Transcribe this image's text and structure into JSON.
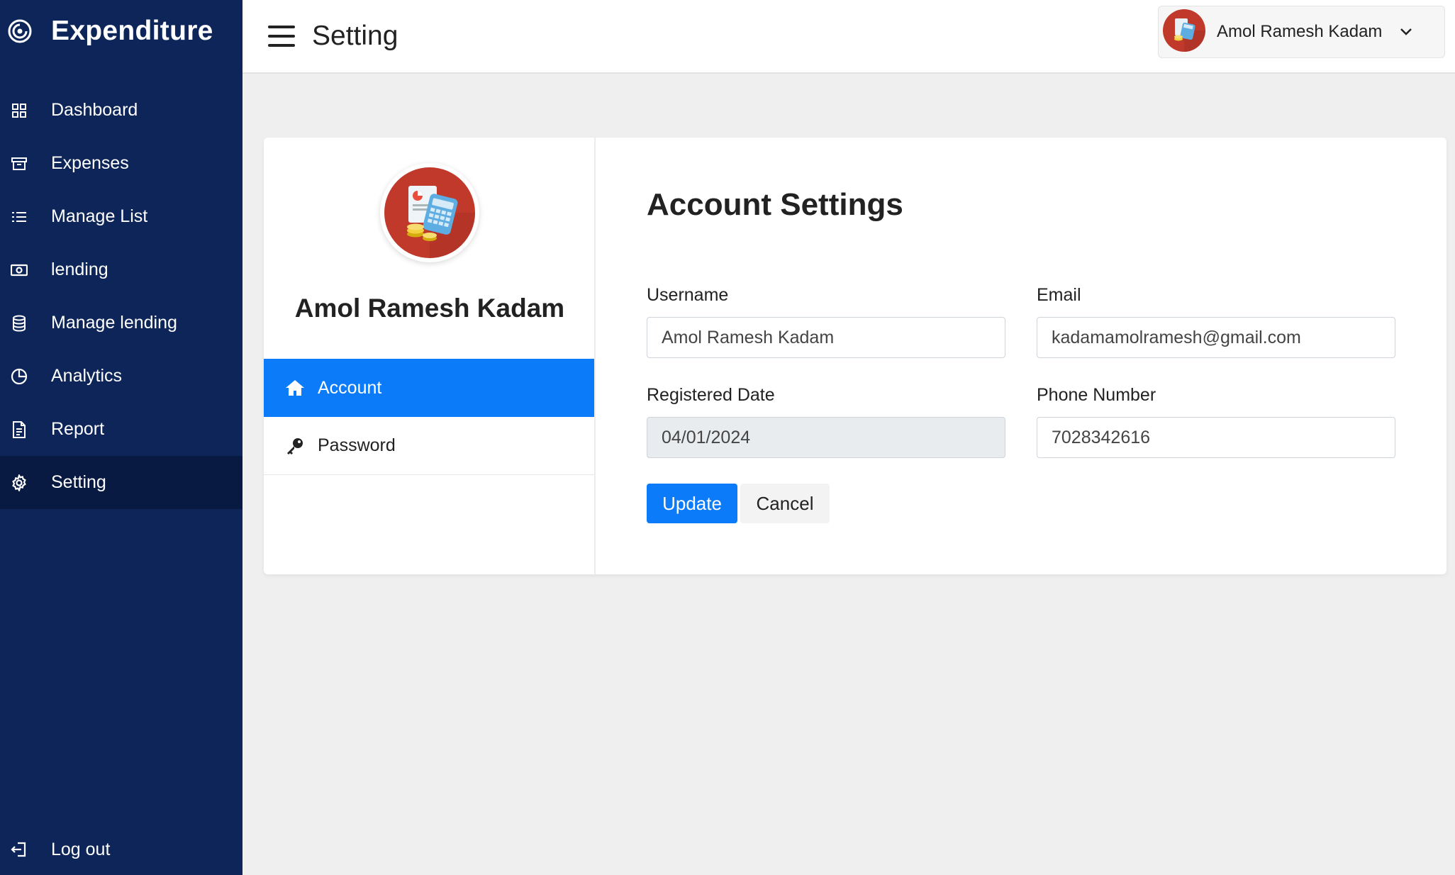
{
  "app": {
    "name": "Expenditure"
  },
  "sidebar": {
    "items": [
      {
        "label": "Dashboard",
        "icon": "grid-icon"
      },
      {
        "label": "Expenses",
        "icon": "archive-icon"
      },
      {
        "label": "Manage List",
        "icon": "list-icon"
      },
      {
        "label": "lending",
        "icon": "cash-icon"
      },
      {
        "label": "Manage lending",
        "icon": "database-icon"
      },
      {
        "label": "Analytics",
        "icon": "pie-chart-icon"
      },
      {
        "label": "Report",
        "icon": "document-icon"
      },
      {
        "label": "Setting",
        "icon": "gear-icon",
        "active": true
      }
    ],
    "logout_label": "Log out"
  },
  "header": {
    "title": "Setting",
    "user_name": "Amol Ramesh Kadam"
  },
  "profile": {
    "name": "Amol Ramesh Kadam",
    "menu": [
      {
        "label": "Account",
        "icon": "home-icon",
        "active": true
      },
      {
        "label": "Password",
        "icon": "key-icon"
      }
    ]
  },
  "account": {
    "title": "Account Settings",
    "username_label": "Username",
    "username_value": "Amol Ramesh Kadam",
    "email_label": "Email",
    "email_value": "kadamamolramesh@gmail.com",
    "registered_label": "Registered Date",
    "registered_value": "04/01/2024",
    "phone_label": "Phone Number",
    "phone_value": "7028342616",
    "update_label": "Update",
    "cancel_label": "Cancel"
  },
  "colors": {
    "sidebar_bg": "#0d2558",
    "sidebar_active": "#091a42",
    "accent": "#0b7bfa",
    "page_bg": "#efefef"
  }
}
